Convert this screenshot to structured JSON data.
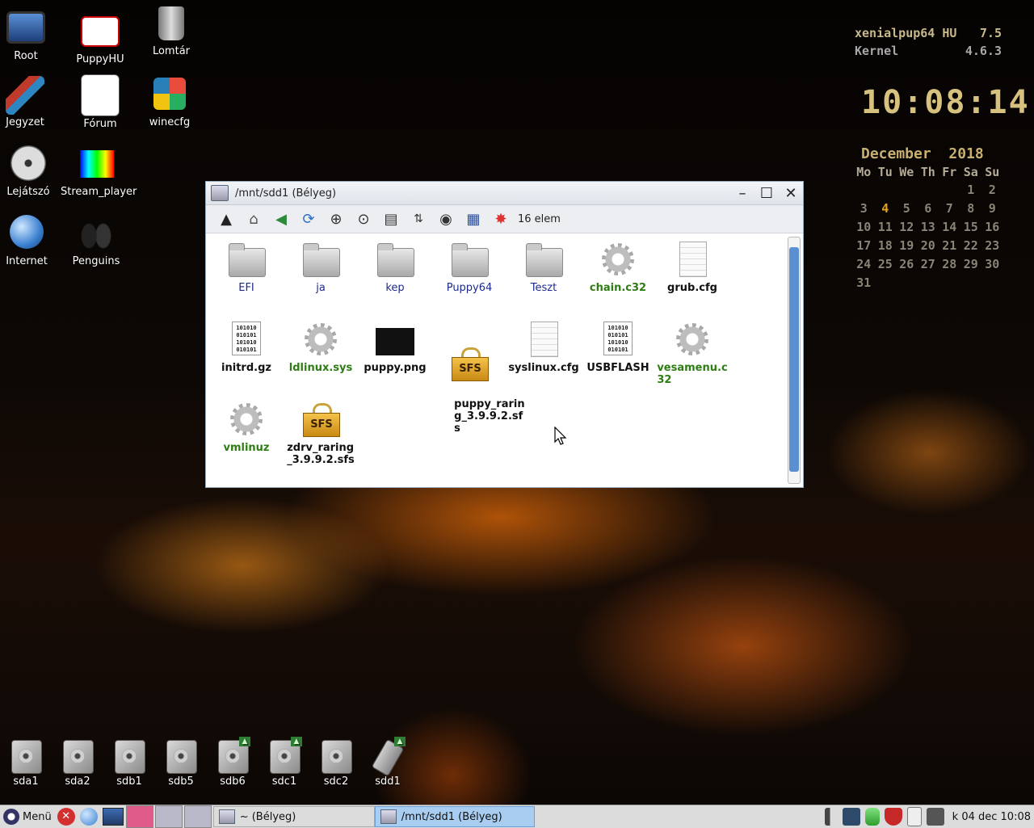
{
  "desktop": {
    "icons": [
      {
        "label": "Root"
      },
      {
        "label": "PuppyHU"
      },
      {
        "label": "Lomtár"
      },
      {
        "label": "Jegyzet"
      },
      {
        "label": "Fórum"
      },
      {
        "label": "winecfg"
      },
      {
        "label": "Lejátszó"
      },
      {
        "label": "Stream_player"
      },
      {
        "label": "Internet"
      },
      {
        "label": "Penguins"
      }
    ],
    "drives": [
      {
        "label": "sda1"
      },
      {
        "label": "sda2"
      },
      {
        "label": "sdb1"
      },
      {
        "label": "sdb5"
      },
      {
        "label": "sdb6"
      },
      {
        "label": "sdc1"
      },
      {
        "label": "sdc2"
      },
      {
        "label": "sdd1"
      }
    ]
  },
  "conky": {
    "distro": "xenialpup64 HU",
    "version": "7.5",
    "kernel_label": "Kernel",
    "kernel_version": "4.6.3",
    "clock": "10:08:14",
    "calendar_title": "December  2018",
    "weekdays": [
      "Mo",
      "Tu",
      "We",
      "Th",
      "Fr",
      "Sa",
      "Su"
    ],
    "weeks": [
      [
        "",
        "",
        "",
        "",
        "",
        "1",
        "2"
      ],
      [
        "3",
        "4",
        "5",
        "6",
        "7",
        "8",
        "9"
      ],
      [
        "10",
        "11",
        "12",
        "13",
        "14",
        "15",
        "16"
      ],
      [
        "17",
        "18",
        "19",
        "20",
        "21",
        "22",
        "23"
      ],
      [
        "24",
        "25",
        "26",
        "27",
        "28",
        "29",
        "30"
      ],
      [
        "31",
        "",
        "",
        "",
        "",
        "",
        ""
      ]
    ],
    "today": "4"
  },
  "window": {
    "title": "/mnt/sdd1 (Bélyeg)",
    "item_count": "16 elem",
    "files": [
      {
        "name": "EFI"
      },
      {
        "name": "ja"
      },
      {
        "name": "kep"
      },
      {
        "name": "Puppy64"
      },
      {
        "name": "Teszt"
      },
      {
        "name": "chain.c32"
      },
      {
        "name": "grub.cfg"
      },
      {
        "name": "initrd.gz"
      },
      {
        "name": "ldlinux.sys"
      },
      {
        "name": "puppy.png"
      },
      {
        "name": "puppy_rarin\ng_3.9.9.2.sf\ns"
      },
      {
        "name": "syslinux.cfg"
      },
      {
        "name": "USBFLASH"
      },
      {
        "name": "vesamenu.c\n32"
      },
      {
        "name": "vmlinuz"
      },
      {
        "name": "zdrv_raring\n_3.9.9.2.sfs"
      }
    ]
  },
  "taskbar": {
    "menu_label": "Menü",
    "tasks": [
      {
        "label": "~ (Bélyeg)"
      },
      {
        "label": "/mnt/sdd1 (Bélyeg)"
      }
    ],
    "clock": "k 04 dec 10:08"
  }
}
